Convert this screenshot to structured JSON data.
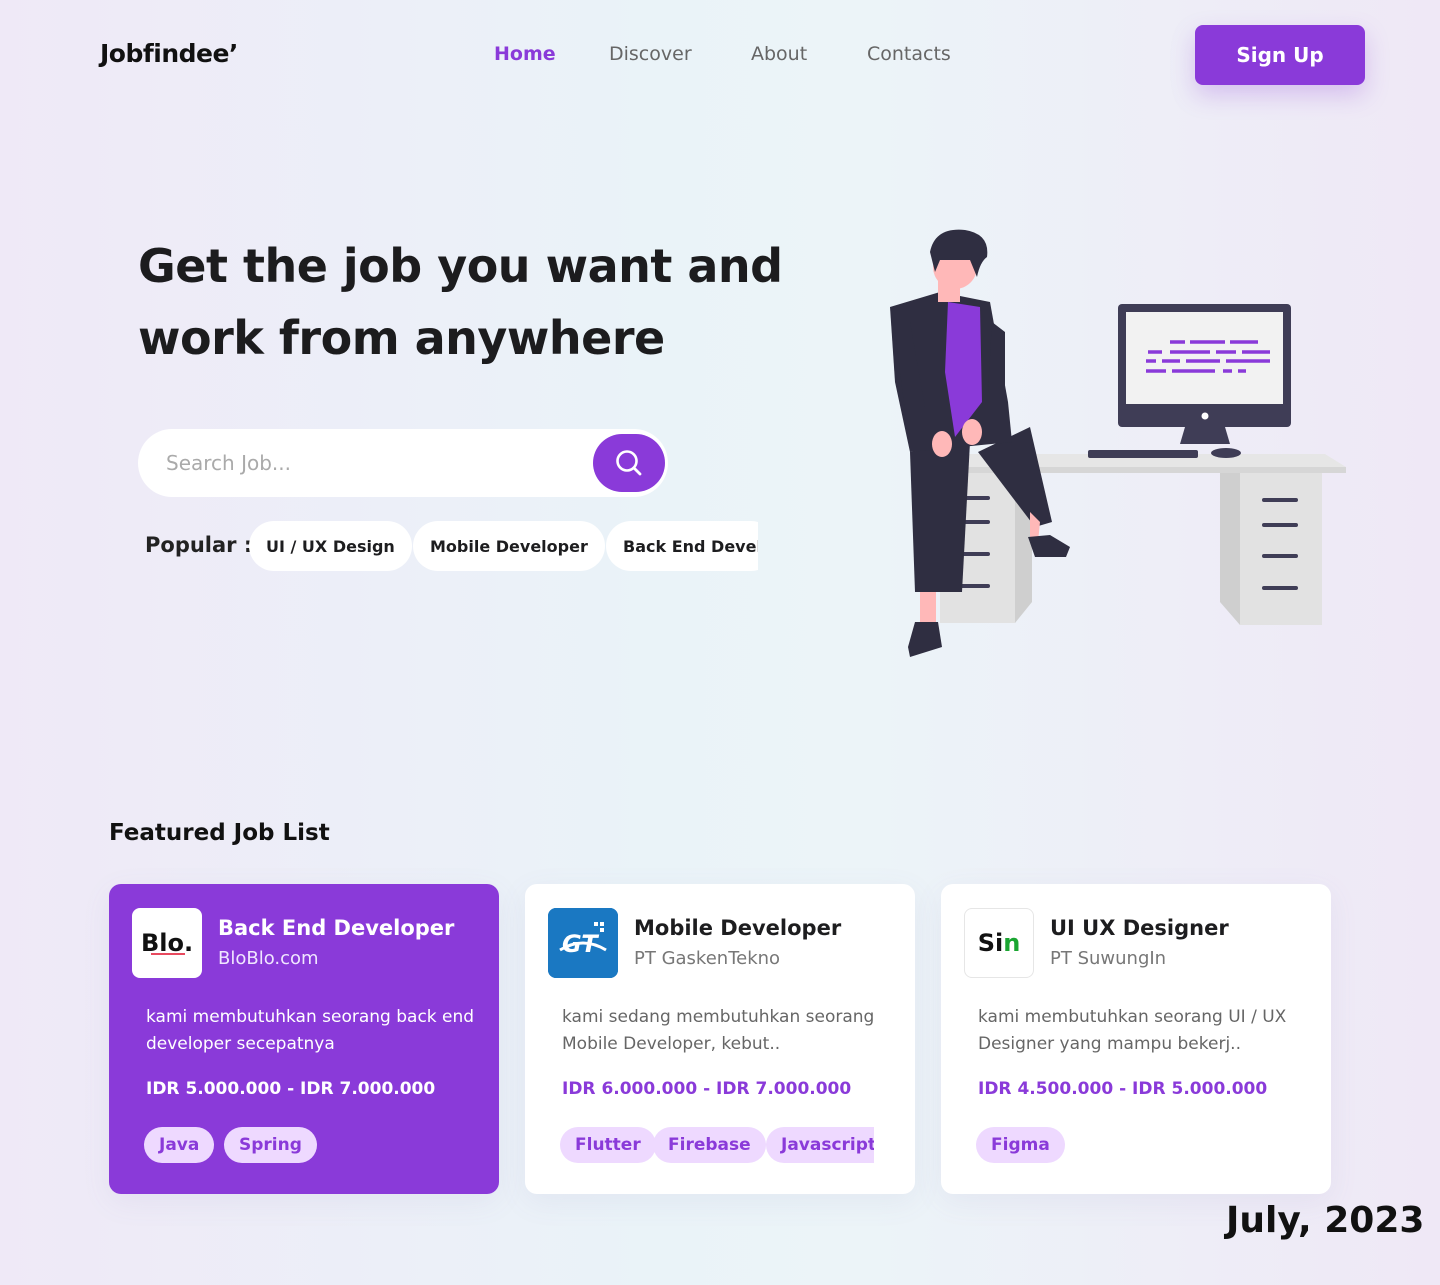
{
  "brand": {
    "logo": "Jobfindee’"
  },
  "nav": {
    "links": [
      {
        "label": "Home",
        "active": true
      },
      {
        "label": "Discover",
        "active": false
      },
      {
        "label": "About",
        "active": false
      },
      {
        "label": "Contacts",
        "active": false
      }
    ],
    "signup_label": "Sign Up"
  },
  "hero": {
    "title_line1": "Get the job you want and",
    "title_line2": "work from anywhere",
    "search_placeholder": "Search Job...",
    "popular_label": "Popular :",
    "popular_tags": [
      "UI / UX Design",
      "Mobile Developer",
      "Back End Developer"
    ]
  },
  "featured": {
    "title": "Featured Job List",
    "jobs": [
      {
        "logo_text": "Blo.",
        "title": "Back End Developer",
        "company": "BloBlo.com",
        "description": "kami membutuhkan seorang back end developer secepatnya",
        "salary": "IDR 5.000.000 - IDR 7.000.000",
        "tags": [
          "Java",
          "Spring"
        ]
      },
      {
        "logo_text": "GT",
        "title": "Mobile Developer",
        "company": "PT GaskenTekno",
        "description": "kami sedang membutuhkan seorang Mobile Developer, kebut..",
        "salary": "IDR 6.000.000 - IDR 7.000.000",
        "tags": [
          "Flutter",
          "Firebase",
          "Javascript"
        ]
      },
      {
        "logo_text_a": "Si",
        "logo_text_b": "n",
        "title": "UI UX Designer",
        "company": "PT SuwungIn",
        "description": "kami membutuhkan seorang UI / UX Designer yang mampu bekerj..",
        "salary": "IDR 4.500.000 - IDR 5.000.000",
        "tags": [
          "Figma"
        ]
      }
    ]
  },
  "footer": {
    "date": "July, 2023"
  },
  "colors": {
    "accent": "#8a3ad9",
    "tag_bg": "#eed9ff",
    "sin_green": "#1aa531",
    "gt_blue": "#1a78c2"
  }
}
